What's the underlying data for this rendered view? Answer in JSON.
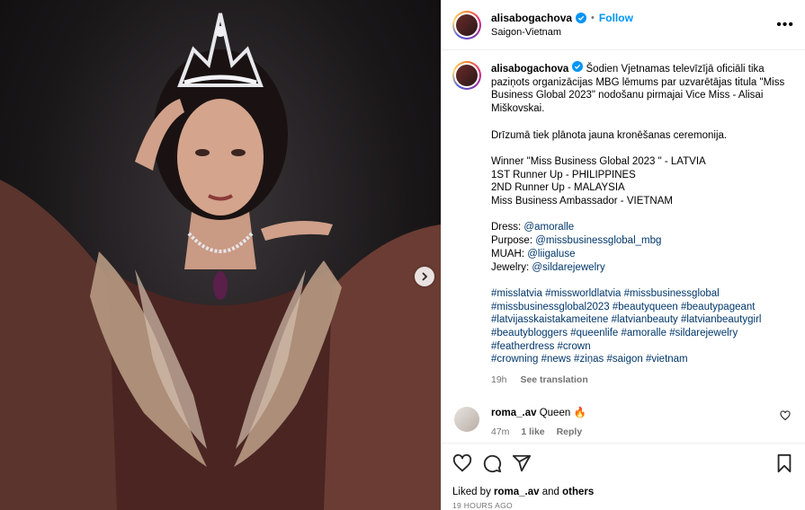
{
  "post": {
    "username": "alisabogachova",
    "follow_label": "Follow",
    "location": "Saigon-Vietnam",
    "more_label": "•••"
  },
  "caption": {
    "username": "alisabogachova",
    "text_first": "Šodien Vjetnamas televīzījā oficiāli tika paziņots organizācijas MBG lēmums par uzvarētājas titula \"Miss Business Global 2023\" nodošanu pirmajai Vice Miss - Alisai Miškovskai.",
    "para2": "Drīzumā tiek plānota jauna kronēšanas ceremonija.",
    "results": [
      "Winner \"Miss Business Global 2023 \" - LATVIA",
      "1ST Runner Up - PHILIPPINES",
      "2ND Runner Up - MALAYSIA",
      "Miss Business Ambassador - VIETNAM"
    ],
    "credits": [
      {
        "label": "Dress: ",
        "handle": "@amoralle"
      },
      {
        "label": "Purpose: ",
        "handle": "@missbusinessglobal_mbg"
      },
      {
        "label": "MUAH: ",
        "handle": "@liigaluse"
      },
      {
        "label": "Jewelry: ",
        "handle": "@sildarejewelry"
      }
    ],
    "hashtag_lines": [
      "#misslatvia #missworldlatvia #missbusinessglobal",
      "#missbusinessglobal2023 #beautyqueen #beautypageant",
      "#latvijasskaistakameitene #latvianbeauty #latvianbeautygirl",
      "#beautybloggers #queenlife #amoralle #sildarejewelry",
      "#featherdress #crown",
      "#crowning #news #ziņas #saigon #vietnam"
    ],
    "age": "19h",
    "see_translation": "See translation"
  },
  "comment": {
    "username": "roma_.av",
    "text": "Queen 🔥",
    "age": "47m",
    "likes": "1 like",
    "reply": "Reply"
  },
  "footer": {
    "liked_prefix": "Liked by ",
    "liked_user": "roma_.av",
    "liked_and": " and ",
    "liked_others": "others",
    "timestamp": "19 HOURS AGO"
  },
  "icons": {
    "verified": "verified-badge-icon",
    "next": "chevron-right-icon",
    "like": "heart-icon",
    "comment": "comment-icon",
    "share": "send-icon",
    "save": "bookmark-icon"
  },
  "colors": {
    "link_blue": "#0095f6",
    "hashtag": "#00376b",
    "muted": "#737373"
  }
}
